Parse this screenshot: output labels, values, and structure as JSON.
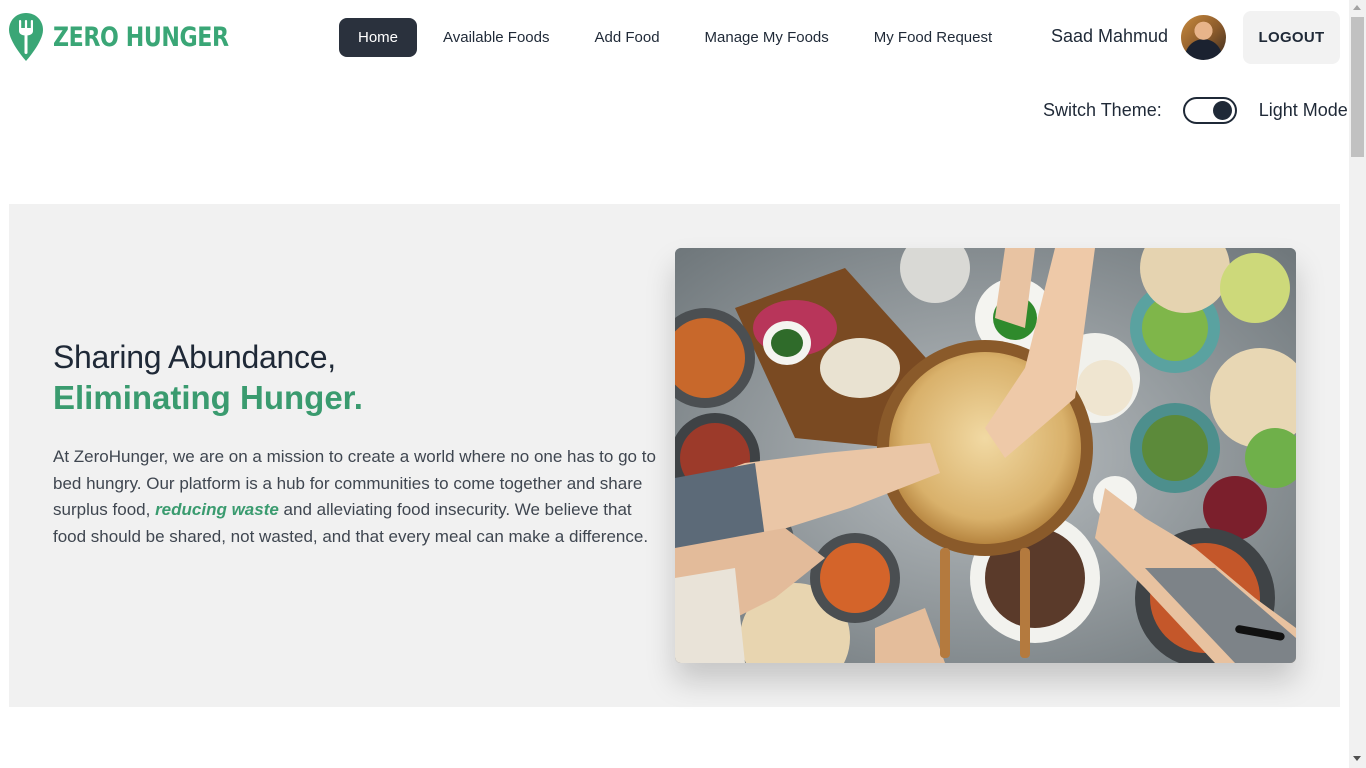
{
  "brand": {
    "name": "ZERO HUNGER",
    "color": "#3aa676"
  },
  "nav": {
    "links": [
      {
        "label": "Home",
        "active": true
      },
      {
        "label": "Available Foods",
        "active": false
      },
      {
        "label": "Add Food",
        "active": false
      },
      {
        "label": "Manage My Foods",
        "active": false
      },
      {
        "label": "My Food Request",
        "active": false
      }
    ],
    "active_bg": "#2a313d"
  },
  "user": {
    "name": "Saad Mahmud",
    "logout_label": "LOGOUT"
  },
  "theme": {
    "label": "Switch Theme:",
    "mode": "Light Mode"
  },
  "hero": {
    "title_line1": "Sharing Abundance,",
    "title_line2": "Eliminating Hunger.",
    "desc_before": "At ZeroHunger, we are on a mission to create a world where no one has to go to bed hungry. Our platform is a hub for communities to come together and share surplus food, ",
    "desc_highlight": "reducing waste",
    "desc_after": " and alleviating food insecurity. We believe that food should be shared, not wasted, and that every meal can make a difference.",
    "accent_color": "#3a9b6f",
    "background": "#f1f1f1"
  }
}
